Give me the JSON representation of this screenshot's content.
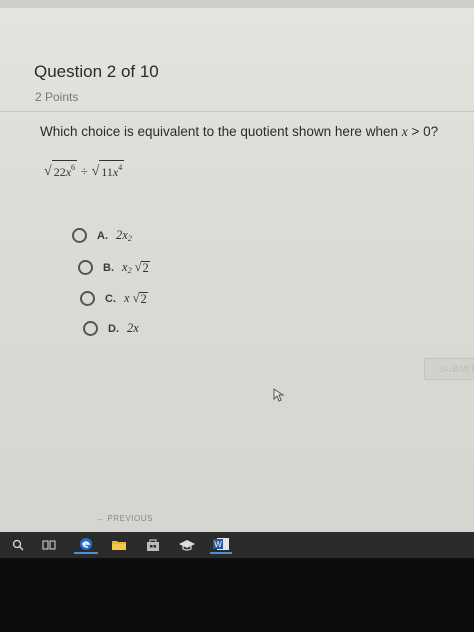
{
  "question": {
    "title": "Question 2 of 10",
    "points": "2 Points",
    "prompt_before": "Which choice is equivalent to the quotient shown here when ",
    "prompt_var": "x",
    "prompt_after": " > 0?",
    "expr": {
      "left_radicand": "22",
      "left_var": "x",
      "left_exp": "6",
      "op": "÷",
      "right_radicand": "11",
      "right_var": "x",
      "right_exp": "4"
    }
  },
  "options": [
    {
      "letter": "A.",
      "value": "2x",
      "sup": "2"
    },
    {
      "letter": "B.",
      "value": "x",
      "sup": "2",
      "sqrt": "2"
    },
    {
      "letter": "C.",
      "value": "x",
      "sqrt": "2"
    },
    {
      "letter": "D.",
      "value": "2x"
    }
  ],
  "submit_label": "SUBMIT",
  "previous_label": "PREVIOUS",
  "taskbar": {
    "icons": [
      "search-icon",
      "task-view-icon",
      "edge-icon",
      "file-explorer-icon",
      "store-icon",
      "education-icon",
      "word-icon"
    ]
  },
  "colors": {
    "page_bg": "#dcdcd6",
    "text": "#2a2a2a",
    "taskbar": "#2b2b2b",
    "accent_blue": "#1e73d6"
  }
}
